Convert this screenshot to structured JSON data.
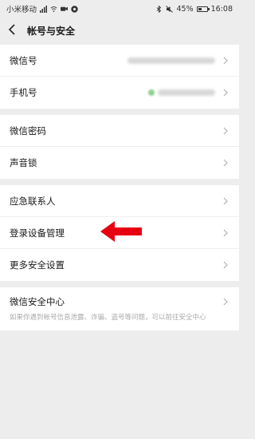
{
  "status_bar": {
    "carrier": "小米移动",
    "battery_percent": "45%",
    "battery_level": 0.45,
    "time": "16:08",
    "icons": [
      "signal-icon",
      "wifi-icon",
      "camera-icon",
      "message-icon",
      "bluetooth-icon",
      "mute-icon"
    ]
  },
  "header": {
    "back_icon": "chevron-left-icon",
    "title": "帐号与安全"
  },
  "groups": [
    {
      "items": [
        {
          "label": "微信号",
          "value": "blurred"
        },
        {
          "label": "手机号",
          "value": "blurred"
        }
      ]
    },
    {
      "items": [
        {
          "label": "微信密码"
        },
        {
          "label": "声音锁"
        }
      ]
    },
    {
      "items": [
        {
          "label": "应急联系人"
        },
        {
          "label": "登录设备管理"
        },
        {
          "label": "更多安全设置"
        }
      ]
    },
    {
      "items": [
        {
          "label": "微信安全中心",
          "description": "如果你遇到帐号信息泄露、诈骗、盗号等问题，可以前往安全中心"
        }
      ]
    }
  ],
  "annotation": {
    "color": "#e60012",
    "icon": "left-arrow-icon"
  }
}
